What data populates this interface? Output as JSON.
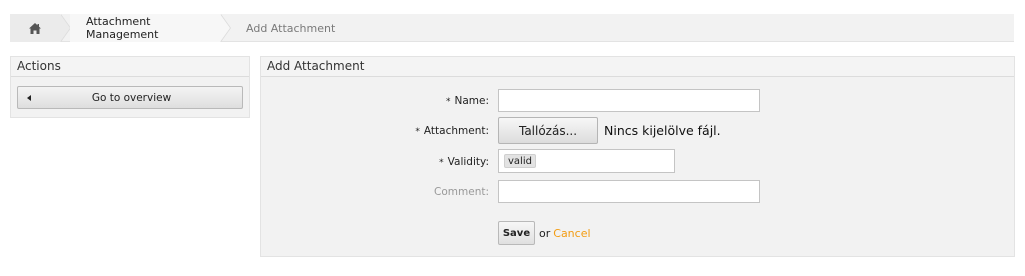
{
  "breadcrumb": {
    "home_icon": "home-icon",
    "items": [
      {
        "label": "Attachment Management"
      },
      {
        "label": "Add Attachment"
      }
    ]
  },
  "sidebar": {
    "title": "Actions",
    "overview_button": {
      "label": "Go to overview",
      "icon": "left-arrow-icon"
    }
  },
  "main": {
    "title": "Add Attachment",
    "fields": {
      "name": {
        "required_mark": "*",
        "label": "Name:",
        "value": ""
      },
      "attachment": {
        "required_mark": "*",
        "label": "Attachment:",
        "button_label": "Tallózás...",
        "status_text": "Nincs kijelölve fájl."
      },
      "validity": {
        "required_mark": "*",
        "label": "Validity:",
        "selected": "valid"
      },
      "comment": {
        "label": "Comment:",
        "value": ""
      }
    },
    "actions": {
      "save_label": "Save",
      "or_text": "or",
      "cancel_label": "Cancel"
    }
  },
  "colors": {
    "accent_link": "#f39c12",
    "panel_bg": "#f2f2f2"
  }
}
